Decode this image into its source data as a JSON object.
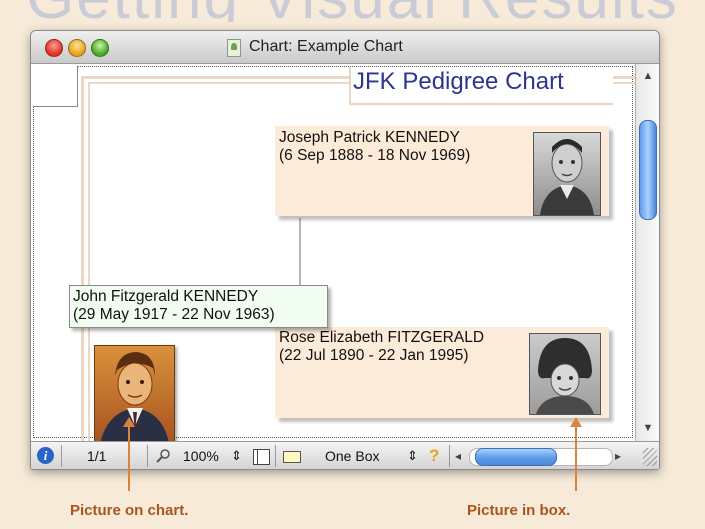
{
  "banner": {
    "text": "Getting Visual Results"
  },
  "window": {
    "title": "Chart: Example Chart",
    "controls": {
      "close": "close-button",
      "minimize": "minimize-button",
      "zoom": "zoom-button"
    }
  },
  "chart": {
    "title": "JFK Pedigree Chart",
    "father": {
      "name": "Joseph Patrick KENNEDY",
      "dates": "(6 Sep 1888 - 18 Nov 1969)"
    },
    "mother": {
      "name": "Rose Elizabeth FITZGERALD",
      "dates": "(22 Jul 1890 - 22 Jan 1995)"
    },
    "subject": {
      "name": "John Fitzgerald KENNEDY",
      "dates": "(29 May 1917 - 22 Nov 1963)"
    }
  },
  "statusbar": {
    "info_icon": "i",
    "page": "1/1",
    "zoom": "100%",
    "zoom_stepper": "⇕",
    "layout": "One Box",
    "layout_stepper": "⇕",
    "help": "?",
    "scroll_left": "◂",
    "scroll_right": "▸",
    "scroll_up": "▲",
    "scroll_down": "▼"
  },
  "captions": {
    "picture_on_chart": "Picture on chart.",
    "picture_in_box": "Picture in box."
  },
  "colors": {
    "title": "#2d3591",
    "box_fill": "#fdebd9",
    "subject_fill": "#f0fdf0",
    "caption": "#a9551f",
    "pointer": "#d9843a"
  }
}
